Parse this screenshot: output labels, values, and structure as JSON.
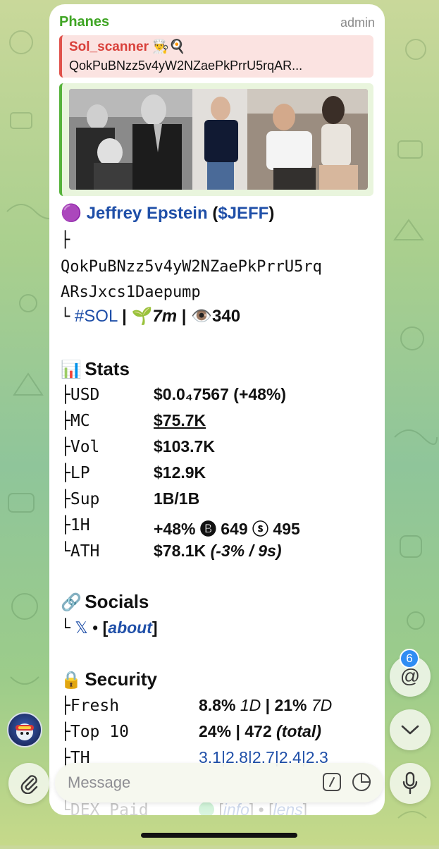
{
  "header": {
    "sender": "Phanes",
    "role": "admin"
  },
  "reply": {
    "name": "Sol_scanner 👨‍🍳🍳",
    "text": "QokPuBNzz5v4yW2NZaePkPrrU5rqAR..."
  },
  "token": {
    "dot": "🟣",
    "name": "Jeffrey Epstein",
    "ticker": "$JEFF",
    "branch_top": "├",
    "address_line1": "QokPuBNzz5v4yW2NZaePkPrrU5rq",
    "address_line2": "ARsJxcs1Daepump",
    "branch_bottom": "└",
    "chain": "#SOL",
    "sep": "|",
    "age_icon": "🌱",
    "age": "7m",
    "views_icon": "👁️",
    "views": "340"
  },
  "stats": {
    "icon": "📊",
    "title": "Stats",
    "rows": [
      {
        "tree": "├",
        "key": "USD",
        "value": "$0.0₄7567 (+48%)"
      },
      {
        "tree": "├",
        "key": "MC",
        "value": "$75.7K"
      },
      {
        "tree": "├",
        "key": "Vol",
        "value": "$103.7K"
      },
      {
        "tree": "├",
        "key": "LP",
        "value": "$12.9K"
      },
      {
        "tree": "├",
        "key": "Sup",
        "value": "1B/1B"
      },
      {
        "tree": "├",
        "key": "1H",
        "value": "+48% 🅑 649 ⓢ 495"
      },
      {
        "tree": "└",
        "key": "ATH",
        "value": "$78.1K",
        "value_extra": "(-3% / 9s)"
      }
    ]
  },
  "socials": {
    "icon": "🔗",
    "title": "Socials",
    "tree": "└",
    "x_icon": "𝕏",
    "dot": "•",
    "about": "about"
  },
  "security": {
    "icon": "🔒",
    "title": "Security",
    "fresh": {
      "tree": "├",
      "key": "Fresh",
      "v1": "8.8%",
      "u1": "1D",
      "sep": "|",
      "v2": "21%",
      "u2": "7D"
    },
    "top10": {
      "tree": "├",
      "key": "Top 10",
      "v1": "24%",
      "sep": "|",
      "v2": "472",
      "u2": "(total)"
    },
    "th": {
      "tree": "├",
      "key": "TH",
      "values": "3.1|2.8|2.7|2.4|2.3"
    },
    "dex": {
      "tree": "└",
      "key": "DEX Paid",
      "info": "info",
      "lens": "lens"
    }
  },
  "composer": {
    "placeholder": "Message",
    "mention_count": "6"
  }
}
